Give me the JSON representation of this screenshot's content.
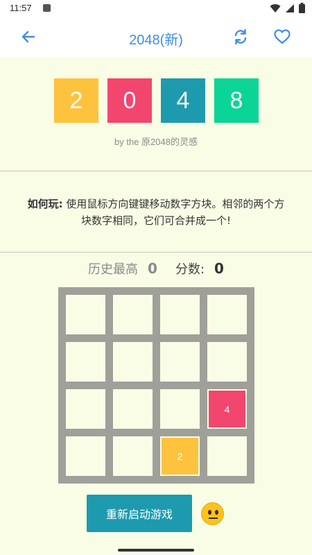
{
  "status_bar": {
    "time": "11:57",
    "icons": [
      "notification-icon",
      "wifi-icon",
      "signal-icon",
      "battery-icon"
    ]
  },
  "app_bar": {
    "title": "2048(新)",
    "back_icon": "arrow-left-icon",
    "refresh_icon": "refresh-icon",
    "favorite_icon": "heart-icon",
    "accent_color": "#3F8DE2"
  },
  "logo": {
    "tiles": [
      {
        "label": "2",
        "color": "#FDC33E"
      },
      {
        "label": "0",
        "color": "#F2466F"
      },
      {
        "label": "4",
        "color": "#1E9AAE"
      },
      {
        "label": "8",
        "color": "#0BD497"
      }
    ],
    "byline": "by the 原2048的灵感"
  },
  "instructions": {
    "title": "如何玩:",
    "text": "使用鼠标方向键键移动数字方块。相邻的两个方块数字相同，它们可合并成一个!"
  },
  "scores": {
    "best_label": "历史最高",
    "best_value": "0",
    "score_label": "分数:",
    "score_value": "0"
  },
  "board": {
    "size": 4,
    "tiles": [
      {
        "row": 2,
        "col": 3,
        "value": "4",
        "color": "#F2466F"
      },
      {
        "row": 3,
        "col": 2,
        "value": "2",
        "color": "#FDC33E"
      }
    ]
  },
  "restart_button": {
    "label": "重新启动游戏",
    "color": "#1E9AAE"
  },
  "mood_icon": "neutral-face-emoji-icon"
}
